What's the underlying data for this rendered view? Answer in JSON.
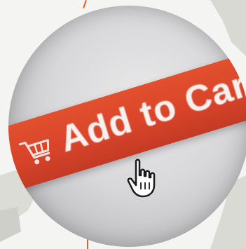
{
  "button": {
    "label": "Add to Cart",
    "icon": "shopping-cart-icon",
    "color": "#d9442a",
    "text_color": "#f6f1ef"
  },
  "cursor": {
    "icon": "hand-pointer-icon"
  },
  "accent_color": "#f05a2a"
}
